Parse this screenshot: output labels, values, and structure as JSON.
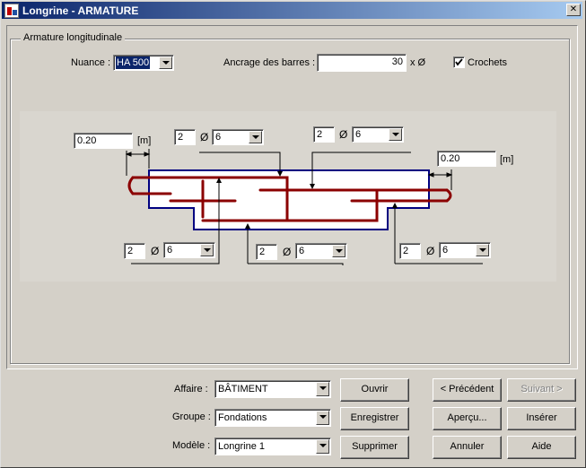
{
  "window": {
    "title": "Longrine - ARMATURE",
    "close_glyph": "✕"
  },
  "group": {
    "label": "Armature longitudinale"
  },
  "nuance": {
    "label": "Nuance :",
    "value": "HA 500"
  },
  "ancrage": {
    "label": "Ancrage des barres :",
    "value": "30",
    "unit": "x Ø"
  },
  "crochets": {
    "label": "Crochets",
    "checked": true
  },
  "drawing": {
    "phi": "Ø",
    "left_width": {
      "value": "0.20",
      "unit": "[m]"
    },
    "right_width": {
      "value": "0.20",
      "unit": "[m]"
    },
    "top_left": {
      "count": "2",
      "diameter": "6"
    },
    "top_right": {
      "count": "2",
      "diameter": "6"
    },
    "bottom_left": {
      "count": "2",
      "diameter": "6"
    },
    "bottom_center": {
      "count": "2",
      "diameter": "6"
    },
    "bottom_right": {
      "count": "2",
      "diameter": "6"
    },
    "colors": {
      "concrete_outline": "#000080",
      "rebar": "#8b0000"
    }
  },
  "bottom": {
    "affaire": {
      "label": "Affaire :",
      "value": "BÂTIMENT"
    },
    "groupe": {
      "label": "Groupe :",
      "value": "Fondations"
    },
    "modele": {
      "label": "Modèle :",
      "value": "Longrine 1"
    },
    "buttons": {
      "ouvrir": "Ouvrir",
      "enregistrer": "Enregistrer",
      "supprimer": "Supprimer",
      "precedent": "< Précédent",
      "suivant": "Suivant >",
      "apercu": "Aperçu...",
      "inserer": "Insérer",
      "annuler": "Annuler",
      "aide": "Aide"
    }
  }
}
